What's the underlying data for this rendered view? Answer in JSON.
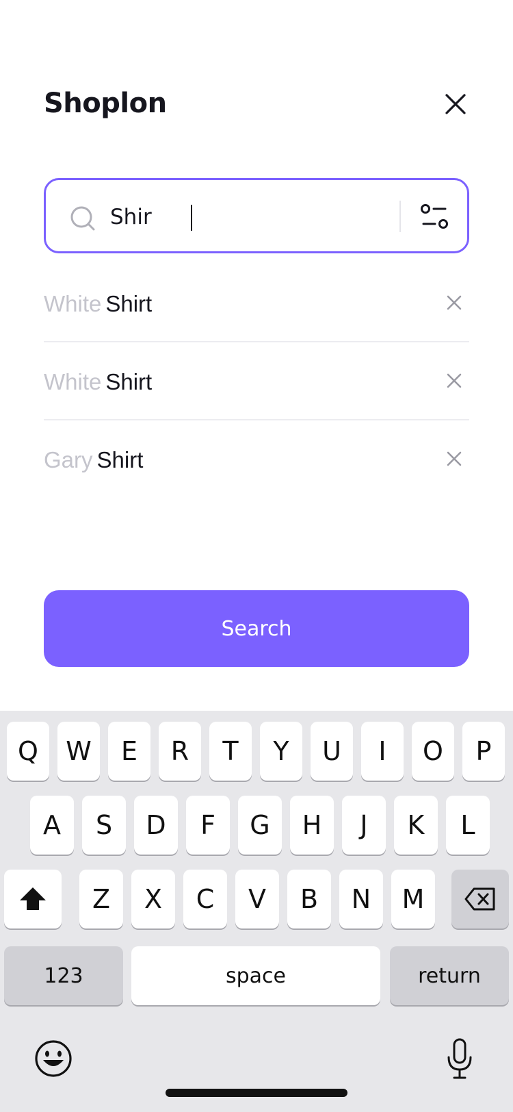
{
  "app": {
    "logo_text": "Shoplon"
  },
  "search": {
    "value": "Shir"
  },
  "suggestions": [
    {
      "prefix": "White",
      "match": "Shirt"
    },
    {
      "prefix": "White",
      "match": "Shirt"
    },
    {
      "prefix": "Gary",
      "match": "Shirt"
    }
  ],
  "search_button": {
    "label": "Search"
  },
  "keyboard": {
    "row1": [
      "Q",
      "W",
      "E",
      "R",
      "T",
      "Y",
      "U",
      "I",
      "O",
      "P"
    ],
    "row2": [
      "A",
      "S",
      "D",
      "F",
      "G",
      "H",
      "J",
      "K",
      "L"
    ],
    "row3": [
      "Z",
      "X",
      "C",
      "V",
      "B",
      "N",
      "M"
    ],
    "numbers_label": "123",
    "space_label": "space",
    "return_label": "return"
  },
  "colors": {
    "accent": "#7b61ff",
    "muted_text": "#c4c4cc",
    "keyboard_bg": "#e7e7ea"
  },
  "icons": [
    "close-icon",
    "search-icon",
    "filter-icon",
    "remove-icon",
    "shift-icon",
    "backspace-icon",
    "emoji-icon",
    "microphone-icon"
  ]
}
